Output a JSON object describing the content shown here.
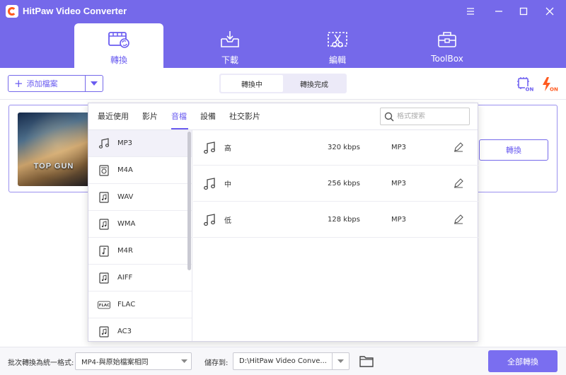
{
  "app": {
    "title": "HitPaw Video Converter"
  },
  "nav": {
    "tabs": [
      {
        "label": "轉換",
        "icon": "film-convert-icon",
        "active": true
      },
      {
        "label": "下載",
        "icon": "download-tray-icon",
        "active": false
      },
      {
        "label": "編輯",
        "icon": "scissors-edit-icon",
        "active": false
      },
      {
        "label": "ToolBox",
        "icon": "toolbox-icon",
        "active": false
      }
    ]
  },
  "toolbar": {
    "add_files_label": "添加檔案",
    "segment": {
      "converting": "轉換中",
      "converted": "轉換完成",
      "active": "converting"
    }
  },
  "file": {
    "thumbnail_title": "TOP GUN",
    "convert_label": "轉換"
  },
  "format_popup": {
    "tabs": [
      {
        "label": "最近使用",
        "active": false
      },
      {
        "label": "影片",
        "active": false
      },
      {
        "label": "音檔",
        "active": true
      },
      {
        "label": "設備",
        "active": false
      },
      {
        "label": "社交影片",
        "active": false
      }
    ],
    "search_placeholder": "格式搜索",
    "formats": [
      {
        "label": "MP3",
        "icon": "music-note-icon",
        "active": true
      },
      {
        "label": "M4A",
        "icon": "audio-file-icon",
        "active": false
      },
      {
        "label": "WAV",
        "icon": "audio-file-icon",
        "active": false
      },
      {
        "label": "WMA",
        "icon": "audio-file-icon",
        "active": false
      },
      {
        "label": "M4R",
        "icon": "audio-file-icon",
        "active": false
      },
      {
        "label": "AIFF",
        "icon": "audio-file-icon",
        "active": false
      },
      {
        "label": "FLAC",
        "icon": "flac-icon",
        "active": false
      },
      {
        "label": "AC3",
        "icon": "audio-file-icon",
        "active": false
      }
    ],
    "qualities": [
      {
        "name": "高",
        "bitrate": "320 kbps",
        "format": "MP3"
      },
      {
        "name": "中",
        "bitrate": "256 kbps",
        "format": "MP3"
      },
      {
        "name": "低",
        "bitrate": "128 kbps",
        "format": "MP3"
      }
    ]
  },
  "bottom": {
    "batch_label": "批次轉換為統一格式:",
    "batch_value": "MP4-與原始檔案相同",
    "save_label": "儲存到:",
    "save_path": "D:\\HitPaw Video Conve...",
    "convert_all_label": "全部轉換"
  },
  "colors": {
    "brand": "#7569ea",
    "accent": "#6a5cf0",
    "orange": "#ff5a1f"
  }
}
